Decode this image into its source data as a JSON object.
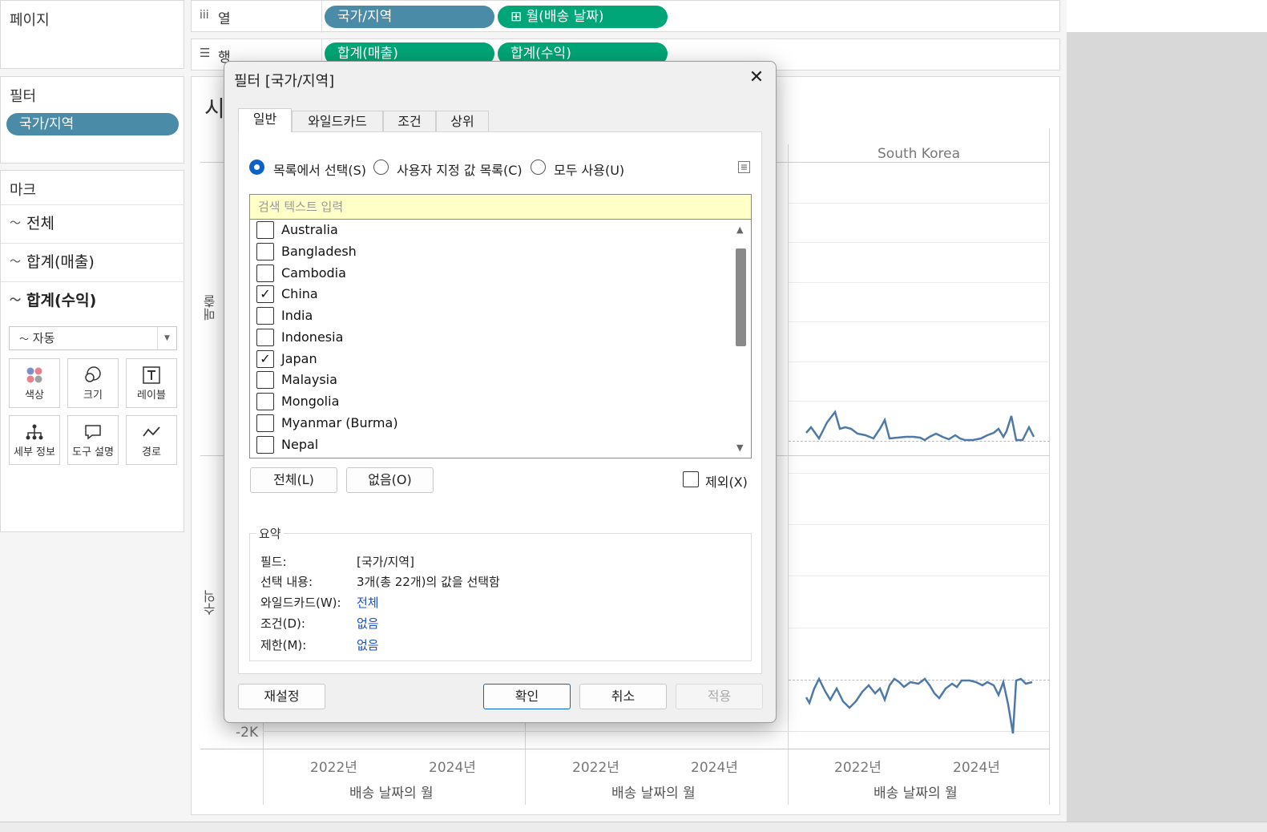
{
  "shelves": {
    "pages_title": "페이지",
    "columns_label": "열",
    "rows_label": "행",
    "columns_pills": [
      "국가/지역",
      "⊞ 월(배송 날짜)"
    ],
    "rows_pills": [
      "합계(매출)",
      "합계(수익)"
    ]
  },
  "filters": {
    "title": "필터",
    "pill": "국가/지역"
  },
  "marks": {
    "title": "마크",
    "rows": [
      "전체",
      "합계(매출)",
      "합계(수익)"
    ],
    "dropdown": "자동",
    "buttons": [
      {
        "label": "색상",
        "icon": "color-dots-icon"
      },
      {
        "label": "크기",
        "icon": "size-circles-icon"
      },
      {
        "label": "레이블",
        "icon": "label-t-icon"
      },
      {
        "label": "세부 정보",
        "icon": "detail-tree-icon"
      },
      {
        "label": "도구 설명",
        "icon": "tooltip-bubble-icon"
      },
      {
        "label": "경로",
        "icon": "path-line-icon"
      }
    ]
  },
  "chart": {
    "title_partial": "시",
    "column_header": "South Korea",
    "y_label_top_partial": "매출",
    "y_label_bottom_partial": "수익",
    "y_tick_bottom": "-2K",
    "x_ticks": [
      "2022년",
      "2024년",
      "2022년",
      "2024년",
      "2022년",
      "2024년"
    ],
    "x_axis_titles": [
      "배송 날짜의 월",
      "배송 날짜의 월",
      "배송 날짜의 월"
    ],
    "line_color": "#4e79a7"
  },
  "dialog": {
    "title": "필터 [국가/지역]",
    "tabs": [
      "일반",
      "와일드카드",
      "조건",
      "상위"
    ],
    "active_tab": "일반",
    "radios": [
      "목록에서 선택(S)",
      "사용자 지정 값 목록(C)",
      "모두 사용(U)"
    ],
    "selected_radio": "목록에서 선택(S)",
    "search_placeholder": "검색 텍스트 입력",
    "items": [
      {
        "label": "Australia",
        "checked": false
      },
      {
        "label": "Bangladesh",
        "checked": false
      },
      {
        "label": "Cambodia",
        "checked": false
      },
      {
        "label": "China",
        "checked": true
      },
      {
        "label": "India",
        "checked": false
      },
      {
        "label": "Indonesia",
        "checked": false
      },
      {
        "label": "Japan",
        "checked": true
      },
      {
        "label": "Malaysia",
        "checked": false
      },
      {
        "label": "Mongolia",
        "checked": false
      },
      {
        "label": "Myanmar (Burma)",
        "checked": false
      },
      {
        "label": "Nepal",
        "checked": false
      }
    ],
    "all_button": "전체(L)",
    "none_button": "없음(O)",
    "exclude_label": "제외(X)",
    "exclude_checked": false,
    "summary": {
      "title": "요약",
      "field_key": "필드:",
      "field_value": "[국가/지역]",
      "selection_key": "선택 내용:",
      "selection_value": "3개(총 22개)의 값을 선택함",
      "wildcard_key": "와일드카드(W):",
      "wildcard_value": "전체",
      "condition_key": "조건(D):",
      "condition_value": "없음",
      "limit_key": "제한(M):",
      "limit_value": "없음"
    },
    "reset_button": "재설정",
    "ok_button": "확인",
    "cancel_button": "취소",
    "apply_button": "적용"
  }
}
